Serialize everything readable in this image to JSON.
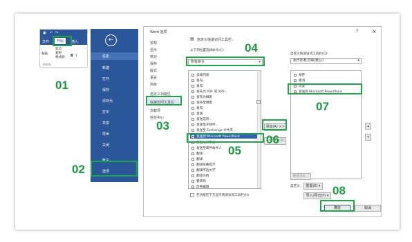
{
  "ribbon": {
    "tabs": [
      "文件",
      "开始",
      "插入"
    ],
    "quick_label": "粘贴",
    "format_painter": "格式刷",
    "cut": "剪切",
    "copy": "复制",
    "clipboard": "剪贴板",
    "bold": "B",
    "italic": "I"
  },
  "backstage": {
    "items": [
      "信息",
      "新建",
      "打开",
      "保存",
      "另存为",
      "打印",
      "共享",
      "导出",
      "关闭"
    ],
    "account": "帐户",
    "options": "选项"
  },
  "dialog": {
    "title": "Word 选项",
    "help": "?",
    "close": "×",
    "nav": [
      "常规",
      "显示",
      "校对",
      "保存",
      "版式",
      "语言",
      "高级",
      "自定义功能区",
      "快速访问工具栏",
      "加载项",
      "信任中心"
    ],
    "heading": "自定义快速访问工具栏。",
    "choose_label": "从下列位置选择命令(C):",
    "choose_value": "所有命令",
    "customize_label": "自定义快速访问工具栏(Q):",
    "customize_value": "用于所有文档(默认)",
    "commands": [
      "多级列表",
      "发布",
      "发布",
      "发布为 PDF 或 XPS",
      "发布为博客",
      "发布至博客",
      "发布",
      "发送",
      "发送选项...",
      "发送电子邮件...",
      "发送至 Exchange 文件夹...",
      "发送到 Microsoft PowerPoint",
      "发送以供审阅...",
      "发送至邮件收件人",
      "翻译...",
      "翻译",
      "翻译屏幕提示",
      "翻译所选文字",
      "翻译文档",
      "繁转简",
      "反映编辑"
    ],
    "selected_command": "发送到 Microsoft PowerPoint",
    "toolbar": [
      "保存",
      "撤消",
      "恢复",
      "发送到 Microsoft PowerPoint"
    ],
    "add_button": "添加(A) >>",
    "remove_button": "<< 删除(R)",
    "modify_button": "修改(M)...",
    "customizations": "自定义:",
    "reset_button": "重置(E) ▾",
    "import_button": "导入/导出(P) ▾",
    "show_below": "在功能区下方显示快速访问工具栏(H)",
    "ok": "确定",
    "cancel": "取消"
  },
  "callouts": [
    "01",
    "02",
    "03",
    "04",
    "05",
    "06",
    "07",
    "08"
  ],
  "colors": {
    "accent": "#2b579a",
    "highlight": "#1aa84a",
    "selection": "#2f62b7"
  }
}
